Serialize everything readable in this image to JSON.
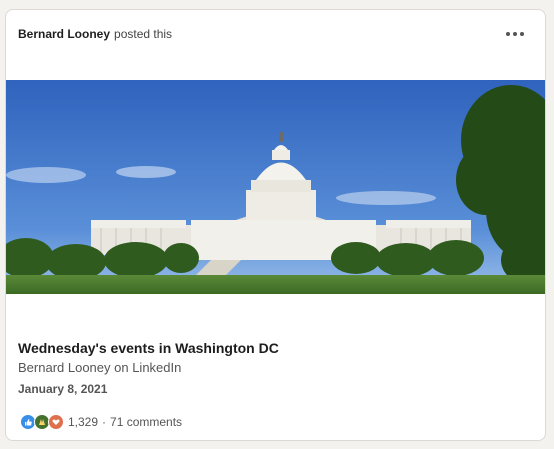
{
  "post": {
    "author": "Bernard Looney",
    "action": "posted this",
    "article_title": "Wednesday's events in Washington DC",
    "article_subtitle": "Bernard Looney on LinkedIn",
    "date": "January 8, 2021",
    "reaction_count": "1,329",
    "separator": "·",
    "comments": "71 comments",
    "reactions": [
      "like-icon",
      "celebrate-icon",
      "love-icon"
    ],
    "image_subject": "capitol-building"
  },
  "colors": {
    "like": "#378fe9",
    "celebrate": "#44712e",
    "love": "#df704d",
    "sky": "#3a73c9",
    "lawn": "#4f7f2f"
  }
}
